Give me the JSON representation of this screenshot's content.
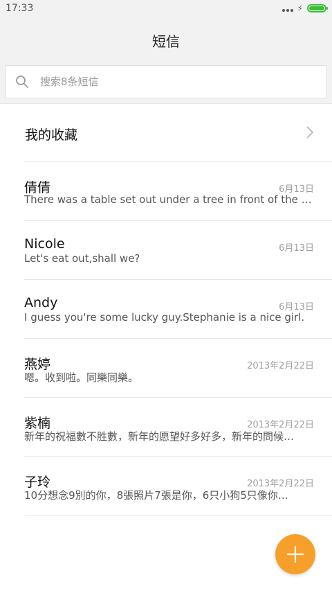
{
  "status_bar": {
    "time": "17:33",
    "charging_icon": "bolt-icon",
    "battery_color": "#3bbf3b"
  },
  "header": {
    "title": "短信"
  },
  "search": {
    "placeholder": "搜索8条短信",
    "icon": "search-icon"
  },
  "favorites": {
    "label": "我的收藏",
    "icon": "chevron-right-icon"
  },
  "messages": [
    {
      "name": "倩倩",
      "date": "6月13日",
      "preview": "There was a table set out under a tree in front of the h…"
    },
    {
      "name": "Nicole",
      "date": "6月13日",
      "preview": "Let's eat out,shall we?"
    },
    {
      "name": "Andy",
      "date": "6月13日",
      "preview": "I guess you're some lucky guy.Stephanie is a nice girl."
    },
    {
      "name": "燕婷",
      "date": "2013年2月22日",
      "preview": "嗯。收到啦。同樂同樂。"
    },
    {
      "name": "紫楠",
      "date": "2013年2月22日",
      "preview": "新年的祝福數不胜數，新年的愿望好多好多，新年的問候…"
    },
    {
      "name": "子玲",
      "date": "2013年2月22日",
      "preview": "10分想念9別的你，8張照片7張是你，6只小狗5只像你…"
    }
  ],
  "compose_button": {
    "icon": "plus-icon",
    "color": "#f6a02b"
  }
}
